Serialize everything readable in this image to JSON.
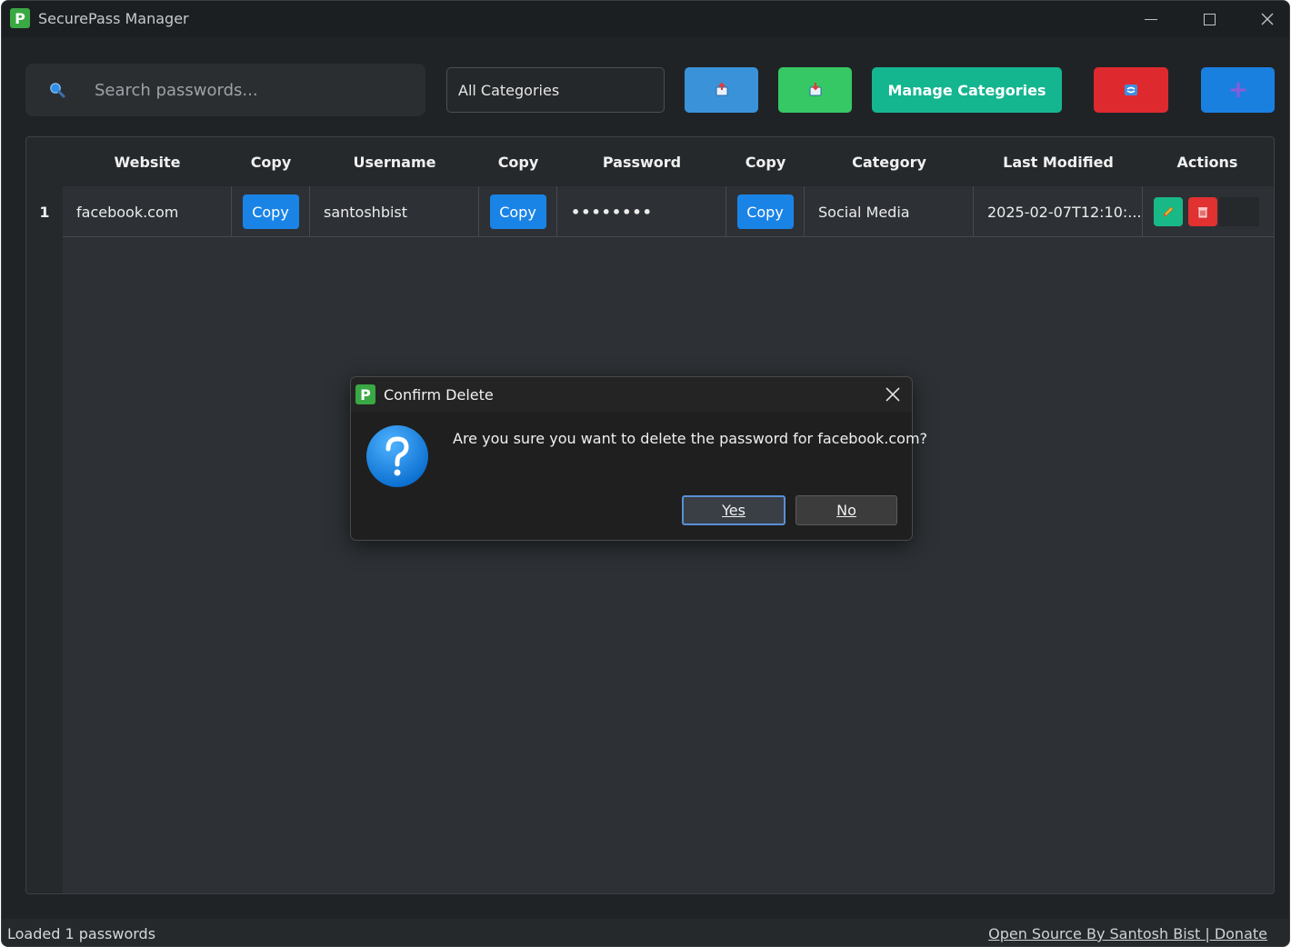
{
  "app": {
    "title": "SecurePass Manager",
    "logo_letter": "P"
  },
  "toolbar": {
    "search_placeholder": "Search passwords...",
    "category_selected": "All Categories",
    "export_icon": "export-box-icon",
    "import_icon": "import-box-icon",
    "manage_label": "Manage Categories",
    "delete_all_icon": "trash-bin-icon",
    "add_icon": "plus-icon"
  },
  "table": {
    "headers": [
      "Website",
      "Copy",
      "Username",
      "Copy",
      "Password",
      "Copy",
      "Category",
      "Last Modified",
      "Actions"
    ],
    "rows": [
      {
        "index": "1",
        "website": "facebook.com",
        "copy_label": "Copy",
        "username": "santoshbist",
        "password": "••••••••",
        "category": "Social Media",
        "last_modified": "2025-02-07T12:10:..."
      }
    ]
  },
  "status": {
    "text": "Loaded 1 passwords",
    "link": "Open Source By Santosh Bist | Donate"
  },
  "dialog": {
    "title": "Confirm Delete",
    "message": "Are you sure you want to delete the password for facebook.com?",
    "yes_label": "Yes",
    "no_label": "No"
  },
  "colors": {
    "accent_blue": "#1a84e6",
    "accent_green": "#14b690",
    "danger_red": "#de2a2f",
    "window_bg": "#202326"
  }
}
